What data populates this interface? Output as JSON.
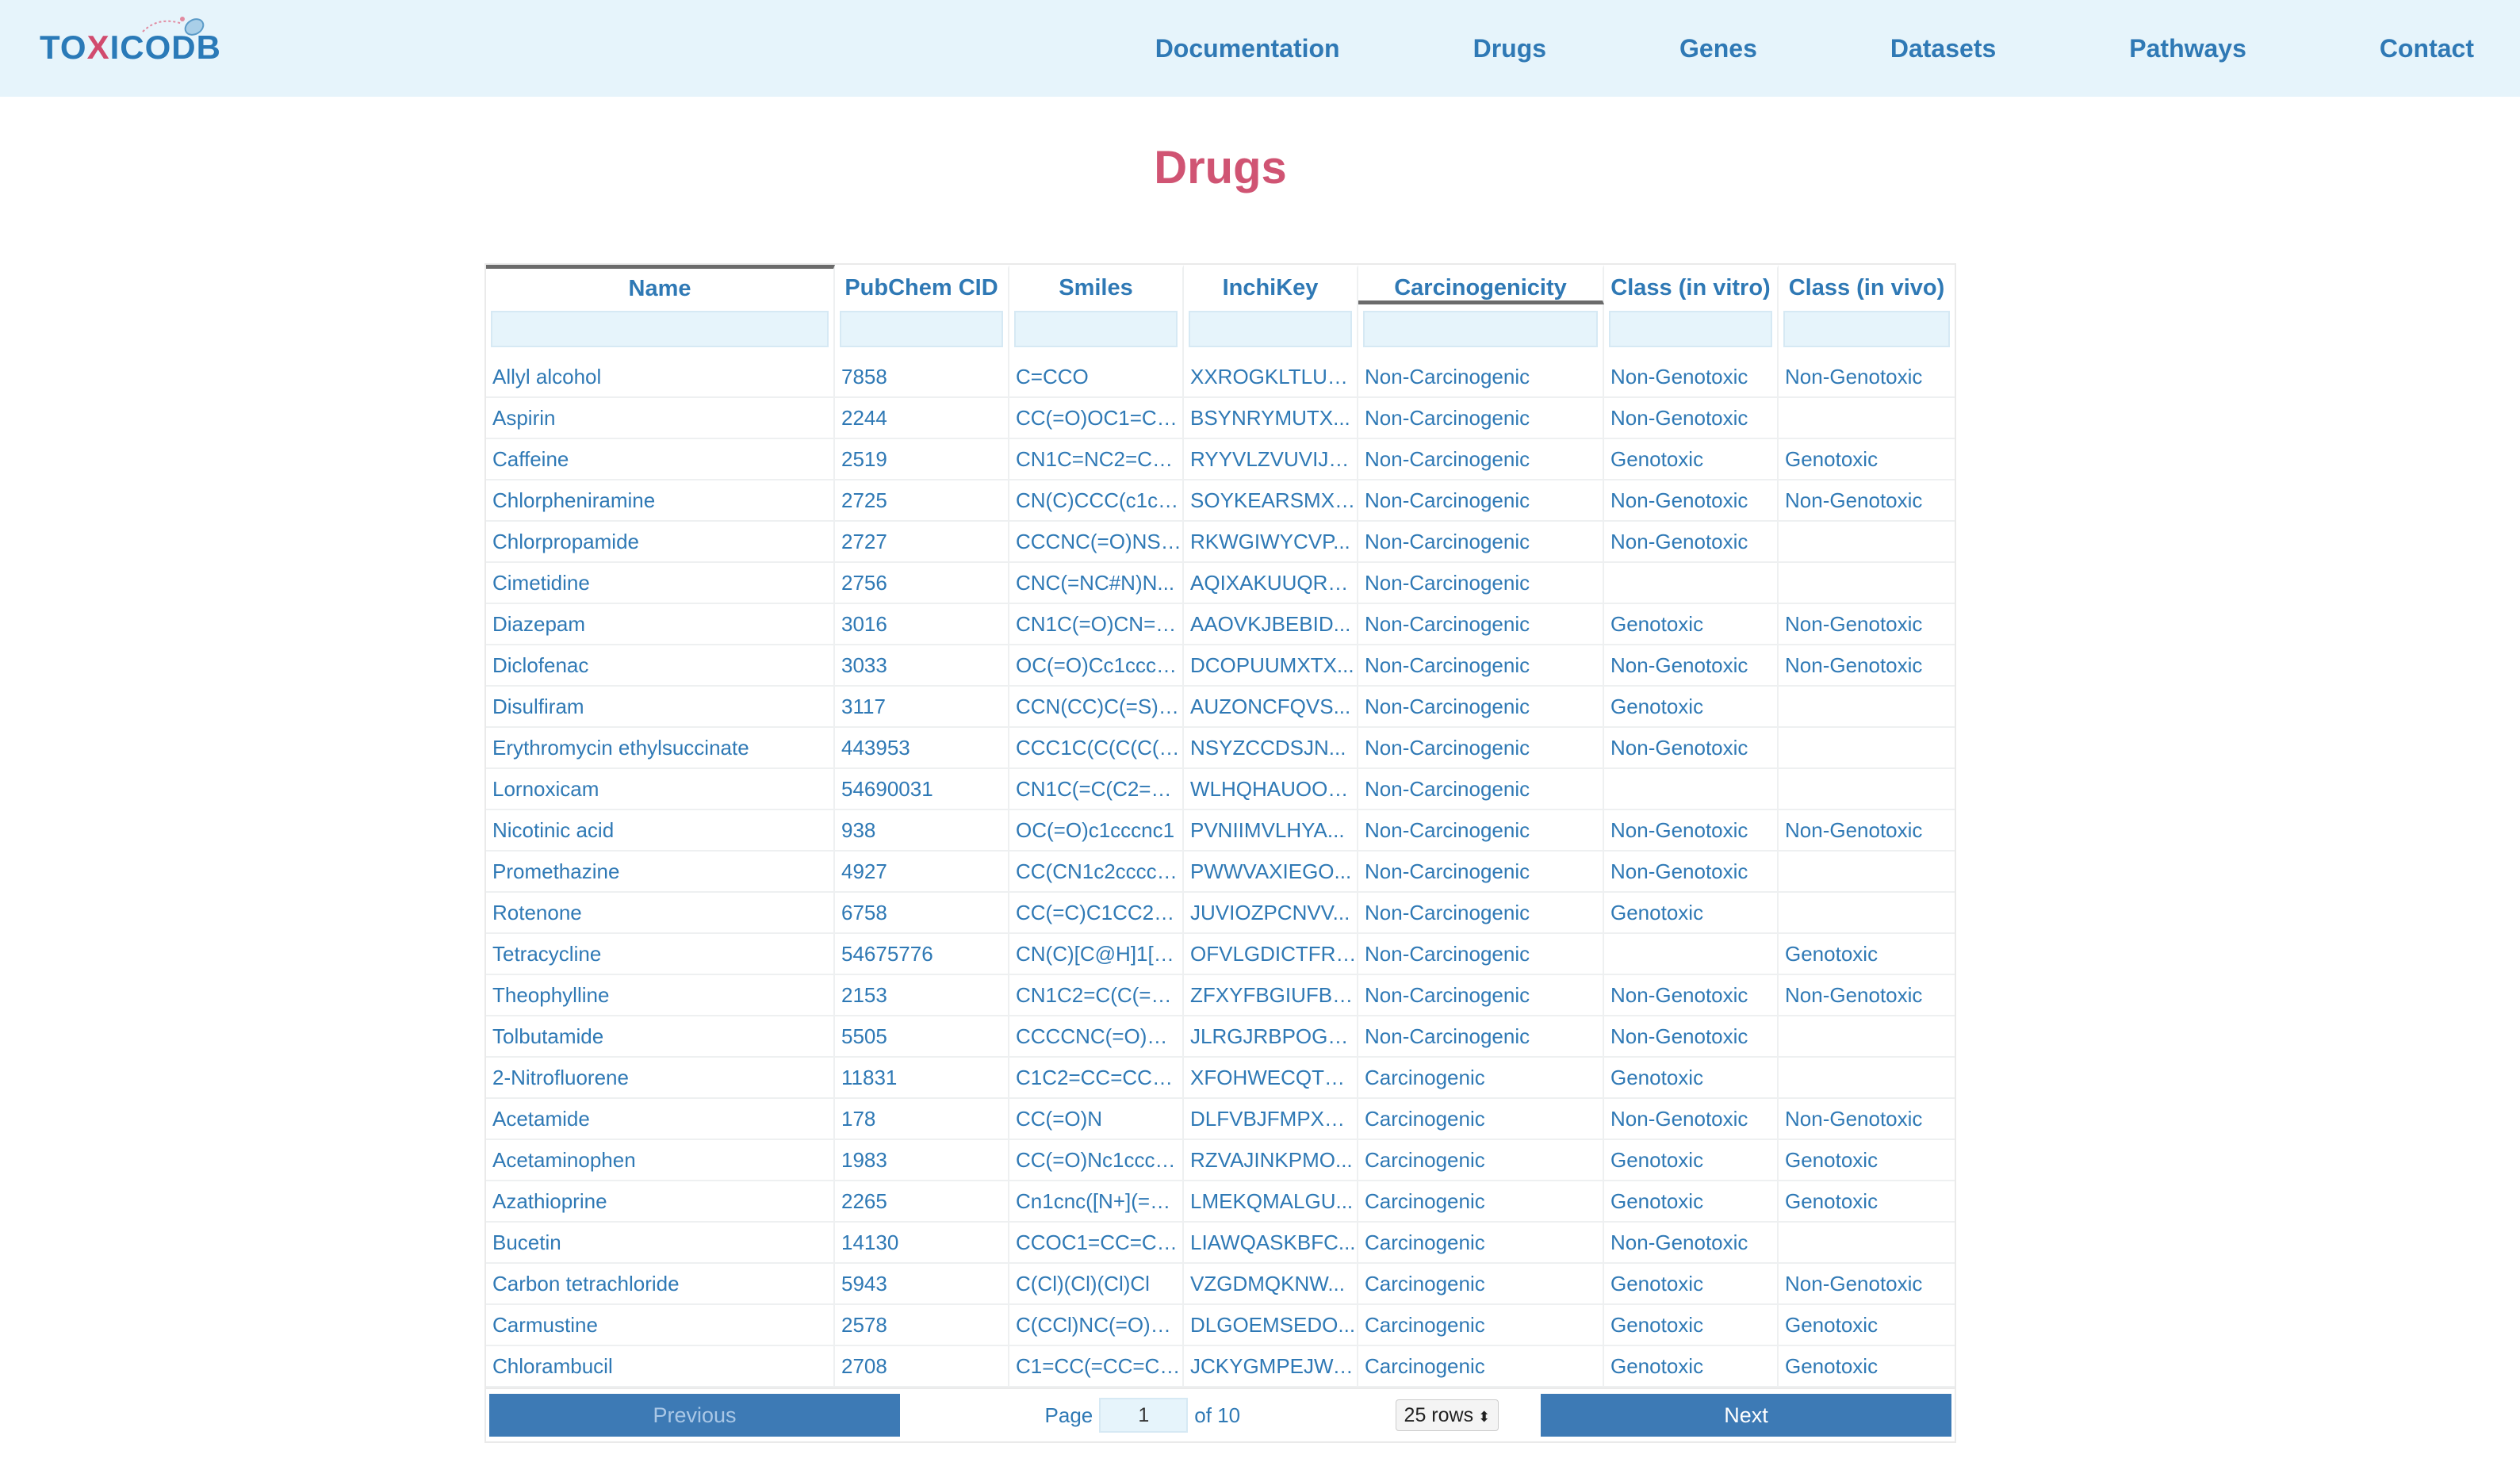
{
  "brand": {
    "prefix": "TO",
    "x": "X",
    "suffix": "ICODB"
  },
  "nav": [
    "Documentation",
    "Drugs",
    "Genes",
    "Datasets",
    "Pathways",
    "Contact"
  ],
  "page_title": "Drugs",
  "table": {
    "columns": [
      "Name",
      "PubChem CID",
      "Smiles",
      "InchiKey",
      "Carcinogenicity",
      "Class (in vitro)",
      "Class (in vivo)"
    ],
    "rows": [
      [
        "Allyl alcohol",
        "7858",
        "C=CCO",
        "XXROGKLTLUQ...",
        "Non-Carcinogenic",
        "Non-Genotoxic",
        "Non-Genotoxic"
      ],
      [
        "Aspirin",
        "2244",
        "CC(=O)OC1=CC=...",
        "BSYNRYMUTX...",
        "Non-Carcinogenic",
        "Non-Genotoxic",
        ""
      ],
      [
        "Caffeine",
        "2519",
        "CN1C=NC2=C1C...",
        "RYYVLZVUVIJV...",
        "Non-Carcinogenic",
        "Genotoxic",
        "Genotoxic"
      ],
      [
        "Chlorpheniramine",
        "2725",
        "CN(C)CCC(c1cc...",
        "SOYKEARSMXG...",
        "Non-Carcinogenic",
        "Non-Genotoxic",
        "Non-Genotoxic"
      ],
      [
        "Chlorpropamide",
        "2727",
        "CCCNC(=O)NS(=...",
        "RKWGIWYCVP...",
        "Non-Carcinogenic",
        "Non-Genotoxic",
        ""
      ],
      [
        "Cimetidine",
        "2756",
        "CNC(=NC#N)N...",
        "AQIXAKUUQRK...",
        "Non-Carcinogenic",
        "",
        ""
      ],
      [
        "Diazepam",
        "3016",
        "CN1C(=O)CN=C(...",
        "AAOVKJBEBID...",
        "Non-Carcinogenic",
        "Genotoxic",
        "Non-Genotoxic"
      ],
      [
        "Diclofenac",
        "3033",
        "OC(=O)Cc1cccc...",
        "DCOPUUMXTX...",
        "Non-Carcinogenic",
        "Non-Genotoxic",
        "Non-Genotoxic"
      ],
      [
        "Disulfiram",
        "3117",
        "CCN(CC)C(=S)S...",
        "AUZONCFQVS...",
        "Non-Carcinogenic",
        "Genotoxic",
        ""
      ],
      [
        "Erythromycin ethylsuccinate",
        "443953",
        "CCC1C(C(C(C(=O...",
        "NSYZCCDSJN...",
        "Non-Carcinogenic",
        "Non-Genotoxic",
        ""
      ],
      [
        "Lornoxicam",
        "54690031",
        "CN1C(=C(C2=C(S...",
        "WLHQHAUOOX...",
        "Non-Carcinogenic",
        "",
        ""
      ],
      [
        "Nicotinic acid",
        "938",
        "OC(=O)c1cccnc1",
        "PVNIIMVLHYA...",
        "Non-Carcinogenic",
        "Non-Genotoxic",
        "Non-Genotoxic"
      ],
      [
        "Promethazine",
        "4927",
        "CC(CN1c2ccccc...",
        "PWWVAXIEGO...",
        "Non-Carcinogenic",
        "Non-Genotoxic",
        ""
      ],
      [
        "Rotenone",
        "6758",
        "CC(=C)C1CC2=C(...",
        "JUVIOZPCNVV...",
        "Non-Carcinogenic",
        "Genotoxic",
        ""
      ],
      [
        "Tetracycline",
        "54675776",
        "CN(C)[C@H]1[C...",
        "OFVLGDICTFRJ...",
        "Non-Carcinogenic",
        "",
        "Genotoxic"
      ],
      [
        "Theophylline",
        "2153",
        "CN1C2=C(C(=O)...",
        "ZFXYFBGIUFBO...",
        "Non-Carcinogenic",
        "Non-Genotoxic",
        "Non-Genotoxic"
      ],
      [
        "Tolbutamide",
        "5505",
        "CCCCNC(=O)NS...",
        "JLRGJRBPOGG...",
        "Non-Carcinogenic",
        "Non-Genotoxic",
        ""
      ],
      [
        "2-Nitrofluorene",
        "11831",
        "C1C2=CC=CC=C...",
        "XFOHWECQTFI...",
        "Carcinogenic",
        "Genotoxic",
        ""
      ],
      [
        "Acetamide",
        "178",
        "CC(=O)N",
        "DLFVBJFMPXG...",
        "Carcinogenic",
        "Non-Genotoxic",
        "Non-Genotoxic"
      ],
      [
        "Acetaminophen",
        "1983",
        "CC(=O)Nc1ccc(O...",
        "RZVAJINKPMO...",
        "Carcinogenic",
        "Genotoxic",
        "Genotoxic"
      ],
      [
        "Azathioprine",
        "2265",
        "Cn1cnc([N+](=O)[...",
        "LMEKQMALGU...",
        "Carcinogenic",
        "Genotoxic",
        "Genotoxic"
      ],
      [
        "Bucetin",
        "14130",
        "CCOC1=CC=C(C...",
        "LIAWQASKBFC...",
        "Carcinogenic",
        "Non-Genotoxic",
        ""
      ],
      [
        "Carbon tetrachloride",
        "5943",
        "C(Cl)(Cl)(Cl)Cl",
        "VZGDMQKNW...",
        "Carcinogenic",
        "Genotoxic",
        "Non-Genotoxic"
      ],
      [
        "Carmustine",
        "2578",
        "C(CCl)NC(=O)N(...",
        "DLGOEMSEDO...",
        "Carcinogenic",
        "Genotoxic",
        "Genotoxic"
      ],
      [
        "Chlorambucil",
        "2708",
        "C1=CC(=CC=C1C...",
        "JCKYGMPEJWA...",
        "Carcinogenic",
        "Genotoxic",
        "Genotoxic"
      ]
    ]
  },
  "pagination": {
    "previous": "Previous",
    "page_label": "Page",
    "page_value": "1",
    "of_label": "of 10",
    "rows_option": "25 rows",
    "next": "Next"
  },
  "colors": {
    "nav_bg": "#e6f4fb",
    "link": "#2f79b5",
    "title": "#d05473",
    "button": "#3d7ab5"
  }
}
